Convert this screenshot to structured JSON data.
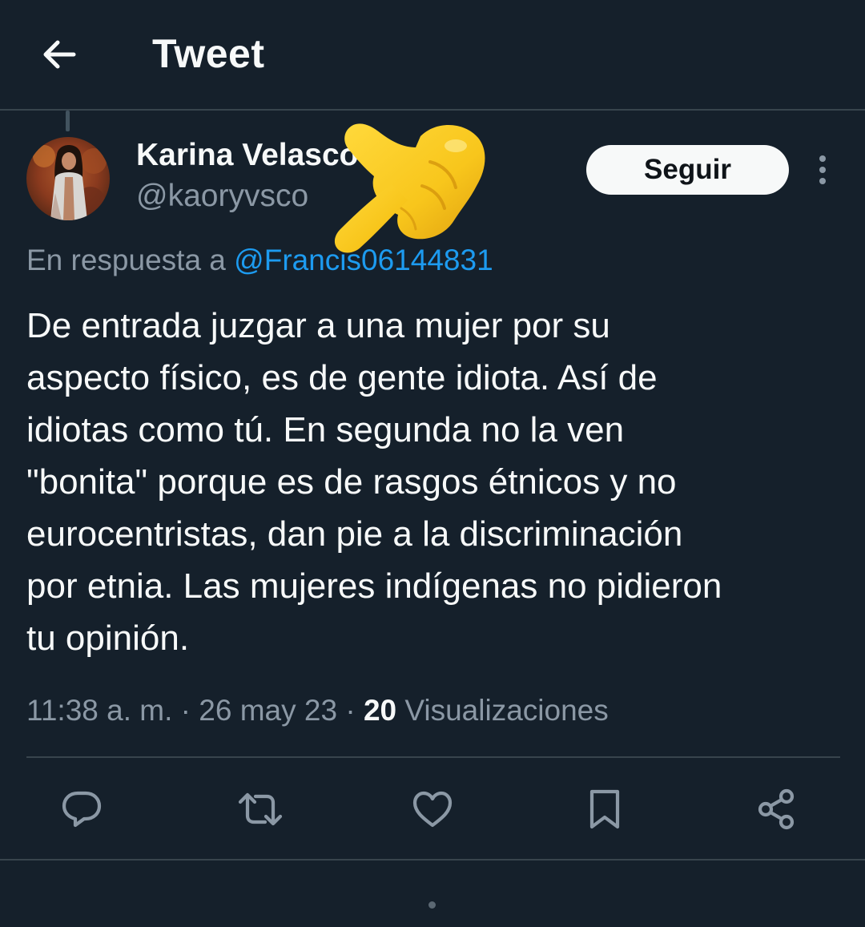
{
  "header": {
    "title": "Tweet",
    "back_icon": "arrow-left-icon"
  },
  "author": {
    "name": "Karina Velasco",
    "handle": "@kaoryvsco",
    "follow_label": "Seguir",
    "more_icon": "more-vertical-icon"
  },
  "reply": {
    "prefix": "En respuesta a ",
    "handle": "@Francis06144831"
  },
  "tweet": {
    "lines": [
      "De entrada juzgar a una mujer por su",
      "aspecto físico, es de gente idiota. Así de",
      "idiotas como tú. En segunda no la ven",
      "\"bonita\" porque es de rasgos étnicos y no",
      "eurocentristas, dan pie a la discriminación",
      "por etnia. Las mujeres indígenas no pidieron",
      "tu opinión."
    ]
  },
  "meta": {
    "time": "11:38 a. m.",
    "sep1": " · ",
    "date": "26 may 23",
    "sep2": " · ",
    "views_count": "20",
    "views_label": " Visualizaciones"
  },
  "actions": {
    "icons": [
      "reply-icon",
      "retweet-icon",
      "like-icon",
      "bookmark-icon",
      "share-icon"
    ]
  },
  "colors": {
    "background": "#15202b",
    "text": "#f7f9f9",
    "secondary_text": "#8b98a5",
    "link": "#1d9bf0",
    "divider": "#38444d",
    "emoji_yellow": "#f8c61c"
  }
}
